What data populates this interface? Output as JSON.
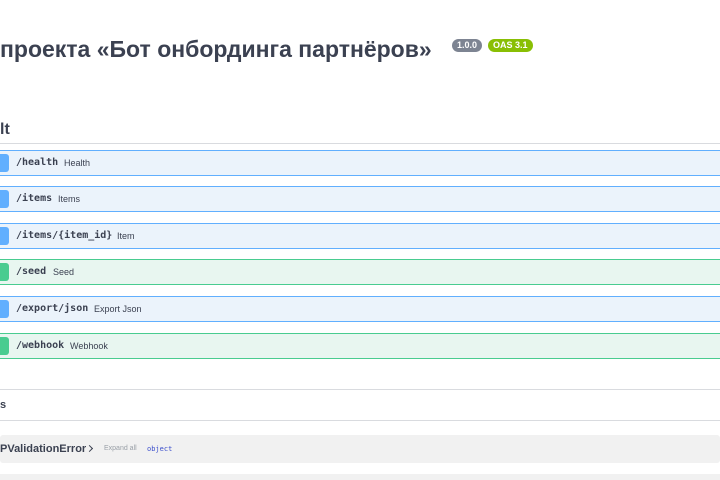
{
  "header": {
    "title": "проекта «Бот онбординга партнёров»",
    "version_badge": "1.0.0",
    "oas_badge": "OAS 3.1"
  },
  "section": {
    "title": "lt"
  },
  "operations": [
    {
      "method": "get",
      "path": "/health",
      "summary": "Health"
    },
    {
      "method": "get",
      "path": "/items",
      "summary": "Items"
    },
    {
      "method": "get",
      "path": "/items/{item_id}",
      "summary": "Item"
    },
    {
      "method": "post",
      "path": "/seed",
      "summary": "Seed"
    },
    {
      "method": "get",
      "path": "/export/json",
      "summary": "Export Json"
    },
    {
      "method": "post",
      "path": "/webhook",
      "summary": "Webhook"
    }
  ],
  "schemas": {
    "title": "s",
    "model": {
      "name": "PValidationError",
      "expand_label": "Expand all",
      "type_label": "object"
    }
  },
  "colors": {
    "get_accent": "#61affe",
    "post_accent": "#49cc90",
    "version_badge": "#7d8492",
    "oas_badge": "#89bf04"
  }
}
